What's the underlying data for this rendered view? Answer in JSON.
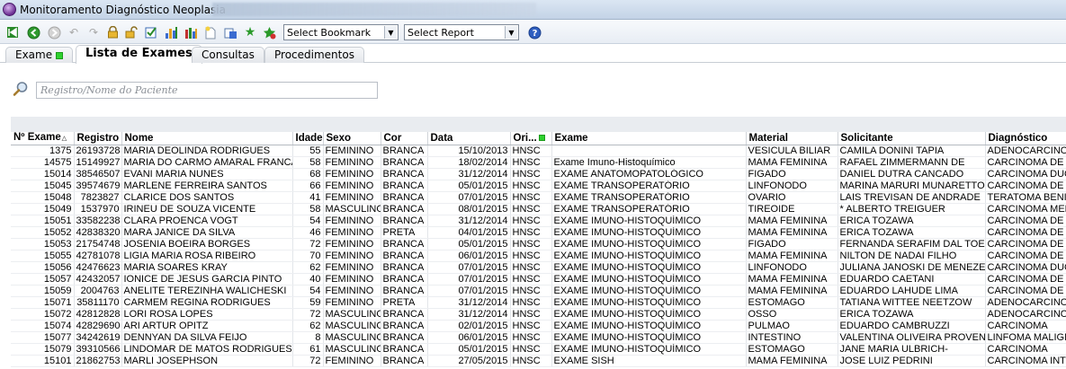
{
  "window": {
    "title": "Monitoramento Diagnóstico Neoplasia"
  },
  "toolbar": {
    "bookmark_select": "Select Bookmark",
    "report_select": "Select Report",
    "icons": [
      "first-record-icon",
      "back-icon",
      "forward-icon",
      "undo-icon",
      "redo-icon",
      "lock-icon",
      "unlock-icon",
      "checkbox-icon",
      "bar-chart-icon",
      "grouped-bar-chart-icon",
      "new-document-icon",
      "print-preview-icon",
      "star-icon",
      "add-bookmark-icon",
      "help-icon"
    ]
  },
  "tabs": [
    {
      "label": "Exame",
      "status_color": "#2fd12f"
    },
    {
      "label": "Lista de Exames"
    },
    {
      "label": "Consultas"
    },
    {
      "label": "Procedimentos"
    }
  ],
  "search": {
    "placeholder": "Registro/Nome do Paciente"
  },
  "table": {
    "columns": [
      "Nº Exame",
      "Registro",
      "Nome",
      "Idade",
      "Sexo",
      "Cor",
      "Data",
      "Ori...",
      "Exame",
      "Material",
      "Solicitante",
      "Diagnóstico"
    ],
    "rows": [
      [
        "1375",
        "26193728",
        "MARIA DEOLINDA RODRIGUES",
        "55",
        "FEMININO",
        "BRANCA",
        "15/10/2013",
        "HNSC",
        "",
        "VESICULA BILIAR",
        "CAMILA DONINI TAPIA",
        "ADENOCARCINOMA"
      ],
      [
        "14575",
        "15149927",
        "MARIA DO CARMO AMARAL FRANCA",
        "58",
        "FEMININO",
        "BRANCA",
        "18/02/2014",
        "HNSC",
        "Exame Imuno-Histoquímico",
        "MAMA FEMININA",
        "RAFAEL ZIMMERMANN DE",
        "CARCINOMA DE D"
      ],
      [
        "15014",
        "38546507",
        "EVANI MARIA NUNES",
        "68",
        "FEMININO",
        "BRANCA",
        "31/12/2014",
        "HNSC",
        "EXAME ANATOMOPATOLÓGICO",
        "FIGADO",
        "DANIEL DUTRA CANCADO",
        "CARCINOMA DUCT"
      ],
      [
        "15045",
        "39574679",
        "MARLENE FERREIRA SANTOS",
        "66",
        "FEMININO",
        "BRANCA",
        "05/01/2015",
        "HNSC",
        "EXAME TRANSOPERATÓRIO",
        "LINFONODO",
        "MARINA MARURI MUNARETTO",
        "CARCINOMA DE D"
      ],
      [
        "15048",
        "7823827",
        "CLARICE DOS SANTOS",
        "41",
        "FEMININO",
        "BRANCA",
        "07/01/2015",
        "HNSC",
        "EXAME TRANSOPERATÓRIO",
        "OVARIO",
        "LAIS TREVISAN DE ANDRADE",
        "TERATOMA BENIG"
      ],
      [
        "15049",
        "1537970",
        "IRINEU DE SOUZA VICENTE",
        "58",
        "MASCULINO",
        "BRANCA",
        "08/01/2015",
        "HNSC",
        "EXAME TRANSOPERATÓRIO",
        "TIREOIDE",
        "* ALBERTO TREIGUER",
        "CARCINOMA MEDU"
      ],
      [
        "15051",
        "33582238",
        "CLARA PROENCA VOGT",
        "54",
        "FEMININO",
        "BRANCA",
        "31/12/2014",
        "HNSC",
        "EXAME IMUNO-HISTOQUÍMICO",
        "MAMA FEMININA",
        "ERICA TOZAWA",
        "CARCINOMA DE D"
      ],
      [
        "15052",
        "42838320",
        "MARA JANICE DA SILVA",
        "46",
        "FEMININO",
        "PRETA",
        "04/01/2015",
        "HNSC",
        "EXAME IMUNO-HISTOQUÍMICO",
        "MAMA FEMININA",
        "ERICA TOZAWA",
        "CARCINOMA DE D"
      ],
      [
        "15053",
        "21754748",
        "JOSENIA BOEIRA BORGES",
        "72",
        "FEMININO",
        "BRANCA",
        "05/01/2015",
        "HNSC",
        "EXAME IMUNO-HISTOQUÍMICO",
        "FIGADO",
        "FERNANDA SERAFIM DAL TOE",
        "CARCINOMA DE D"
      ],
      [
        "15055",
        "42781078",
        "LIGIA MARIA ROSA RIBEIRO",
        "70",
        "FEMININO",
        "BRANCA",
        "06/01/2015",
        "HNSC",
        "EXAME IMUNO-HISTOQUÍMICO",
        "MAMA FEMININA",
        "NILTON DE NADAI FILHO",
        "CARCINOMA DE D"
      ],
      [
        "15056",
        "42476623",
        "MARIA SOARES KRAY",
        "62",
        "FEMININO",
        "BRANCA",
        "07/01/2015",
        "HNSC",
        "EXAME IMUNO-HISTOQUÍMICO",
        "LINFONODO",
        "JULIANA JANOSKI DE MENEZES",
        "CARCINOMA DUCT"
      ],
      [
        "15057",
        "42432057",
        "IONICE DE JESUS GARCIA PINTO",
        "40",
        "FEMININO",
        "BRANCA",
        "07/01/2015",
        "HNSC",
        "EXAME IMUNO-HISTOQUÍMICO",
        "MAMA FEMININA",
        "EDUARDO CAETANI",
        "CARCINOMA DE D"
      ],
      [
        "15059",
        "2004763",
        "ANELITE TEREZINHA WALICHESKI",
        "54",
        "FEMININO",
        "BRANCA",
        "07/01/2015",
        "HNSC",
        "EXAME IMUNO-HISTOQUÍMICO",
        "MAMA FEMININA",
        "EDUARDO LAHUDE LIMA",
        "CARCINOMA DE D"
      ],
      [
        "15071",
        "35811170",
        "CARMEM REGINA RODRIGUES",
        "59",
        "FEMININO",
        "PRETA",
        "31/12/2014",
        "HNSC",
        "EXAME IMUNO-HISTOQUÍMICO",
        "ESTOMAGO",
        "TATIANA WITTEE NEETZOW",
        "ADENOCARCINOM"
      ],
      [
        "15072",
        "42812828",
        "LORI ROSA LOPES",
        "72",
        "MASCULINO",
        "BRANCA",
        "31/12/2014",
        "HNSC",
        "EXAME IMUNO-HISTOQUÍMICO",
        "OSSO",
        "ERICA TOZAWA",
        "ADENOCARCINOM"
      ],
      [
        "15074",
        "42829690",
        "ARI ARTUR OPITZ",
        "62",
        "MASCULINO",
        "BRANCA",
        "02/01/2015",
        "HNSC",
        "EXAME IMUNO-HISTOQUÍMICO",
        "PULMAO",
        "EDUARDO CAMBRUZZI",
        "CARCINOMA"
      ],
      [
        "15077",
        "34242619",
        "DENNYAN DA SILVA FEIJO",
        "8",
        "MASCULINO",
        "BRANCA",
        "06/01/2015",
        "HNSC",
        "EXAME IMUNO-HISTOQUÍMICO",
        "INTESTINO",
        "VALENTINA OLIVEIRA PROVENZI",
        "LINFOMA MALIGN"
      ],
      [
        "15079",
        "39310566",
        "LINDOMAR DE MATOS RODRIGUES",
        "61",
        "MASCULINO",
        "BRANCA",
        "05/01/2015",
        "HNSC",
        "EXAME IMUNO-HISTOQUÍMICO",
        "ESTOMAGO",
        "JANE MARIA ULBRICH-",
        "CARCINOMA"
      ],
      [
        "15101",
        "21862753",
        "MARLI JOSEPHSON",
        "72",
        "FEMININO",
        "BRANCA",
        "27/05/2015",
        "HNSC",
        "EXAME SISH",
        "MAMA FEMININA",
        "JOSE LUIZ PEDRINI",
        "CARCINOMA INTR"
      ]
    ]
  }
}
